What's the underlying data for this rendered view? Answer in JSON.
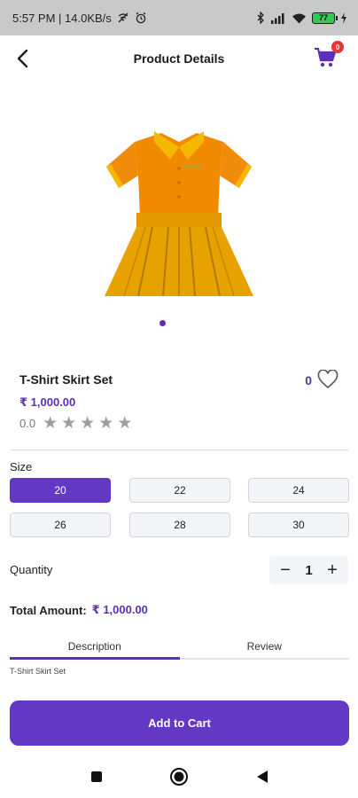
{
  "status_bar": {
    "time_speed": "5:57 PM | 14.0KB/s",
    "battery": "77"
  },
  "header": {
    "title": "Product Details",
    "cart_badge": "0"
  },
  "product": {
    "name": "T-Shirt Skirt Set",
    "price": "₹ 1,000.00",
    "like_count": "0",
    "rating_value": "0.0",
    "rating_stars": 0,
    "image_name": "orange-tshirt-skirt-set-image"
  },
  "size": {
    "label": "Size",
    "options": [
      "20",
      "22",
      "24",
      "26",
      "28",
      "30"
    ],
    "selected": "20"
  },
  "quantity": {
    "label": "Quantity",
    "value": "1",
    "minus": "−",
    "plus": "+"
  },
  "total": {
    "label": "Total Amount:",
    "value": "₹ 1,000.00"
  },
  "tabs": [
    {
      "label": "Description",
      "active": true
    },
    {
      "label": "Review",
      "active": false
    }
  ],
  "description_text": "T-Shirt Skirt Set",
  "add_to_cart_label": "Add to Cart",
  "colors": {
    "accent": "#6338c4",
    "heart": "#5b2fb8",
    "badge": "#e53935",
    "battery": "#34c759"
  }
}
